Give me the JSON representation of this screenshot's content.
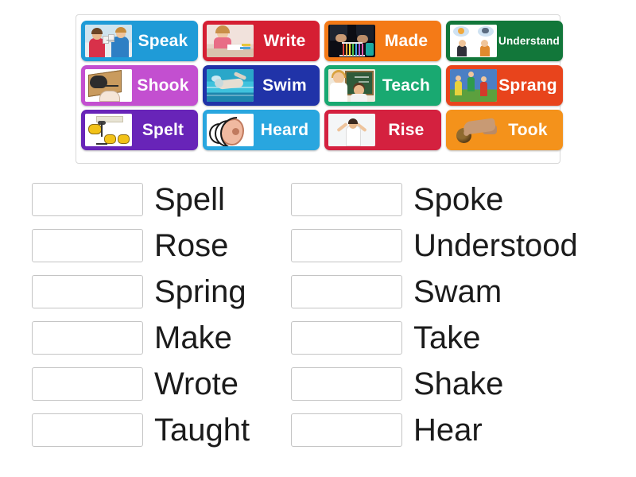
{
  "activity": {
    "type": "match-up",
    "tile_bank": {
      "rows": [
        [
          {
            "label": "Speak",
            "color": "#1f9bd7",
            "art": "speak",
            "framed": true,
            "label_size": "normal"
          },
          {
            "label": "Write",
            "color": "#d51f33",
            "art": "write",
            "framed": true,
            "label_size": "normal"
          },
          {
            "label": "Made",
            "color": "#f47a17",
            "art": "made",
            "framed": true,
            "label_size": "normal"
          },
          {
            "label": "Understand",
            "color": "#12773a",
            "art": "understand",
            "framed": true,
            "label_size": "small"
          }
        ],
        [
          {
            "label": "Shook",
            "color": "#c34fd0",
            "art": "shook",
            "framed": true,
            "label_size": "normal"
          },
          {
            "label": "Swim",
            "color": "#2033a8",
            "art": "swim",
            "framed": true,
            "label_size": "normal"
          },
          {
            "label": "Teach",
            "color": "#19a971",
            "art": "teach",
            "framed": true,
            "label_size": "normal"
          },
          {
            "label": "Sprang",
            "color": "#e8441c",
            "art": "sprang",
            "framed": true,
            "label_size": "normal"
          }
        ],
        [
          {
            "label": "Spelt",
            "color": "#6824b8",
            "art": "spelt",
            "framed": true,
            "label_size": "normal"
          },
          {
            "label": "Heard",
            "color": "#29a6df",
            "art": "heard",
            "framed": true,
            "label_size": "normal"
          },
          {
            "label": "Rise",
            "color": "#d4213f",
            "art": "rise",
            "framed": true,
            "label_size": "normal"
          },
          {
            "label": "Took",
            "color": "#f4921b",
            "art": "took",
            "framed": false,
            "label_size": "normal"
          }
        ]
      ]
    },
    "answer_list": {
      "left_column": [
        {
          "word": "Spell",
          "answer": ""
        },
        {
          "word": "Rose",
          "answer": ""
        },
        {
          "word": "Spring",
          "answer": ""
        },
        {
          "word": "Make",
          "answer": ""
        },
        {
          "word": "Wrote",
          "answer": ""
        },
        {
          "word": "Taught",
          "answer": ""
        }
      ],
      "right_column": [
        {
          "word": "Spoke",
          "answer": ""
        },
        {
          "word": "Understood",
          "answer": ""
        },
        {
          "word": "Swam",
          "answer": ""
        },
        {
          "word": "Take",
          "answer": ""
        },
        {
          "word": "Shake",
          "answer": ""
        },
        {
          "word": "Hear",
          "answer": ""
        }
      ]
    }
  }
}
